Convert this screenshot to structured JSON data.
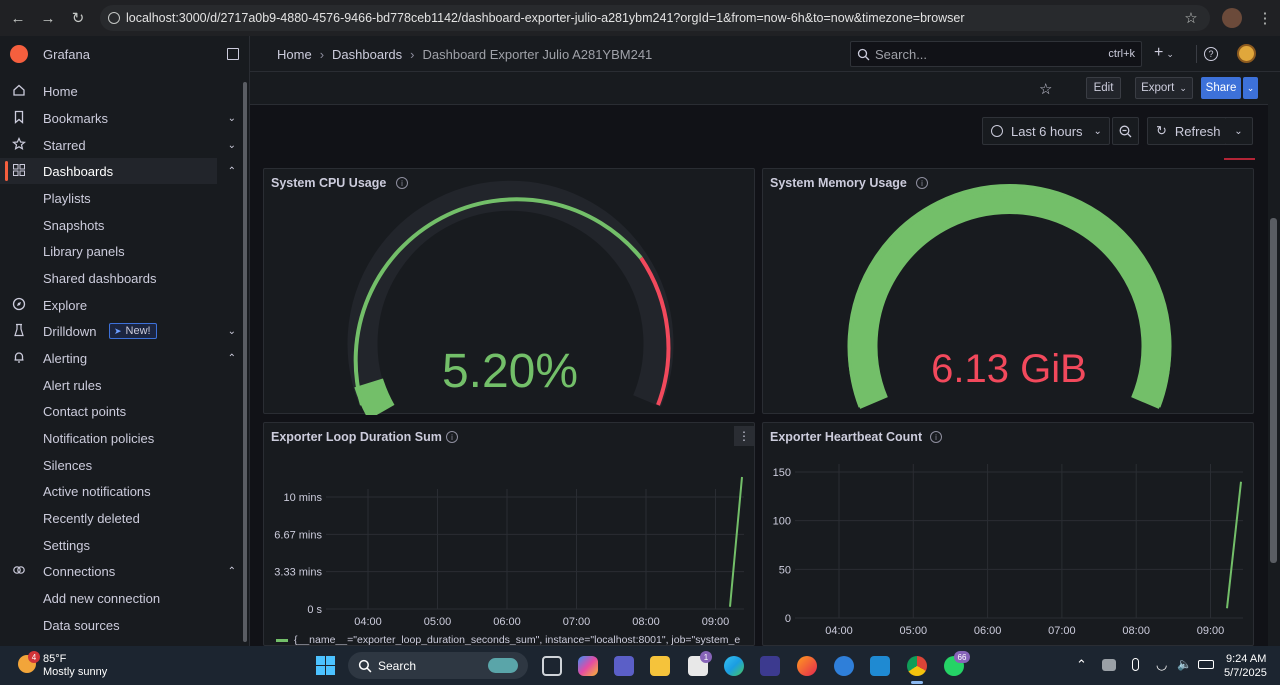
{
  "browser": {
    "url": "localhost:3000/d/2717a0b9-4880-4576-9466-bd778ceb1142/dashboard-exporter-julio-a281ybm241?orgId=1&from=now-6h&to=now&timezone=browser"
  },
  "sidebar": {
    "app_name": "Grafana",
    "items": [
      {
        "label": "Home",
        "icon": "home-icon"
      },
      {
        "label": "Bookmarks",
        "icon": "bookmark-icon"
      },
      {
        "label": "Starred",
        "icon": "star-icon"
      },
      {
        "label": "Dashboards",
        "icon": "apps-icon"
      },
      {
        "label": "Playlists"
      },
      {
        "label": "Snapshots"
      },
      {
        "label": "Library panels"
      },
      {
        "label": "Shared dashboards"
      },
      {
        "label": "Explore",
        "icon": "compass-icon"
      },
      {
        "label": "Drilldown",
        "icon": "drilldown-icon",
        "badge": "New!"
      },
      {
        "label": "Alerting",
        "icon": "bell-icon"
      },
      {
        "label": "Alert rules"
      },
      {
        "label": "Contact points"
      },
      {
        "label": "Notification policies"
      },
      {
        "label": "Silences"
      },
      {
        "label": "Active notifications"
      },
      {
        "label": "Recently deleted"
      },
      {
        "label": "Settings"
      },
      {
        "label": "Connections",
        "icon": "connections-icon"
      },
      {
        "label": "Add new connection"
      },
      {
        "label": "Data sources"
      }
    ]
  },
  "topbar": {
    "breadcrumb": [
      "Home",
      "Dashboards",
      "Dashboard Exporter Julio A281YBM241"
    ],
    "search_placeholder": "Search...",
    "search_shortcut": "ctrl+k"
  },
  "toolbar": {
    "edit": "Edit",
    "export": "Export",
    "share": "Share",
    "time_range": "Last 6 hours",
    "refresh": "Refresh"
  },
  "panels": {
    "cpu": {
      "title": "System CPU Usage",
      "value": "5.20%",
      "percent": 5.2,
      "color": "#73bf69"
    },
    "memory": {
      "title": "System Memory Usage",
      "value": "6.13 GiB",
      "color": "#f2495c"
    },
    "loop": {
      "title": "Exporter Loop Duration Sum",
      "yticks": [
        "10 mins",
        "6.67 mins",
        "3.33 mins",
        "0 s"
      ],
      "xticks": [
        "04:00",
        "05:00",
        "06:00",
        "07:00",
        "08:00",
        "09:00"
      ],
      "legend": "{__name__=\"exporter_loop_duration_seconds_sum\", instance=\"localhost:8001\", job=\"system_e"
    },
    "heartbeat": {
      "title": "Exporter Heartbeat Count",
      "yticks": [
        "150",
        "100",
        "50",
        "0"
      ],
      "xticks": [
        "04:00",
        "05:00",
        "06:00",
        "07:00",
        "08:00",
        "09:00"
      ]
    }
  },
  "chart_data": [
    {
      "type": "line",
      "title": "Exporter Loop Duration Sum",
      "x": [
        "09:12",
        "09:20"
      ],
      "y_minutes": [
        0.2,
        12
      ],
      "ylim": [
        0,
        10
      ],
      "unit": "mins"
    },
    {
      "type": "line",
      "title": "Exporter Heartbeat Count",
      "x": [
        "09:12",
        "09:20"
      ],
      "values": [
        10,
        140
      ],
      "ylim": [
        0,
        150
      ]
    }
  ],
  "taskbar": {
    "weather_temp": "85°F",
    "weather_desc": "Mostly sunny",
    "weather_badge": "4",
    "search": "Search",
    "time": "9:24 AM",
    "date": "5/7/2025",
    "whatsapp_badge": "66",
    "teams_badge": "1"
  }
}
